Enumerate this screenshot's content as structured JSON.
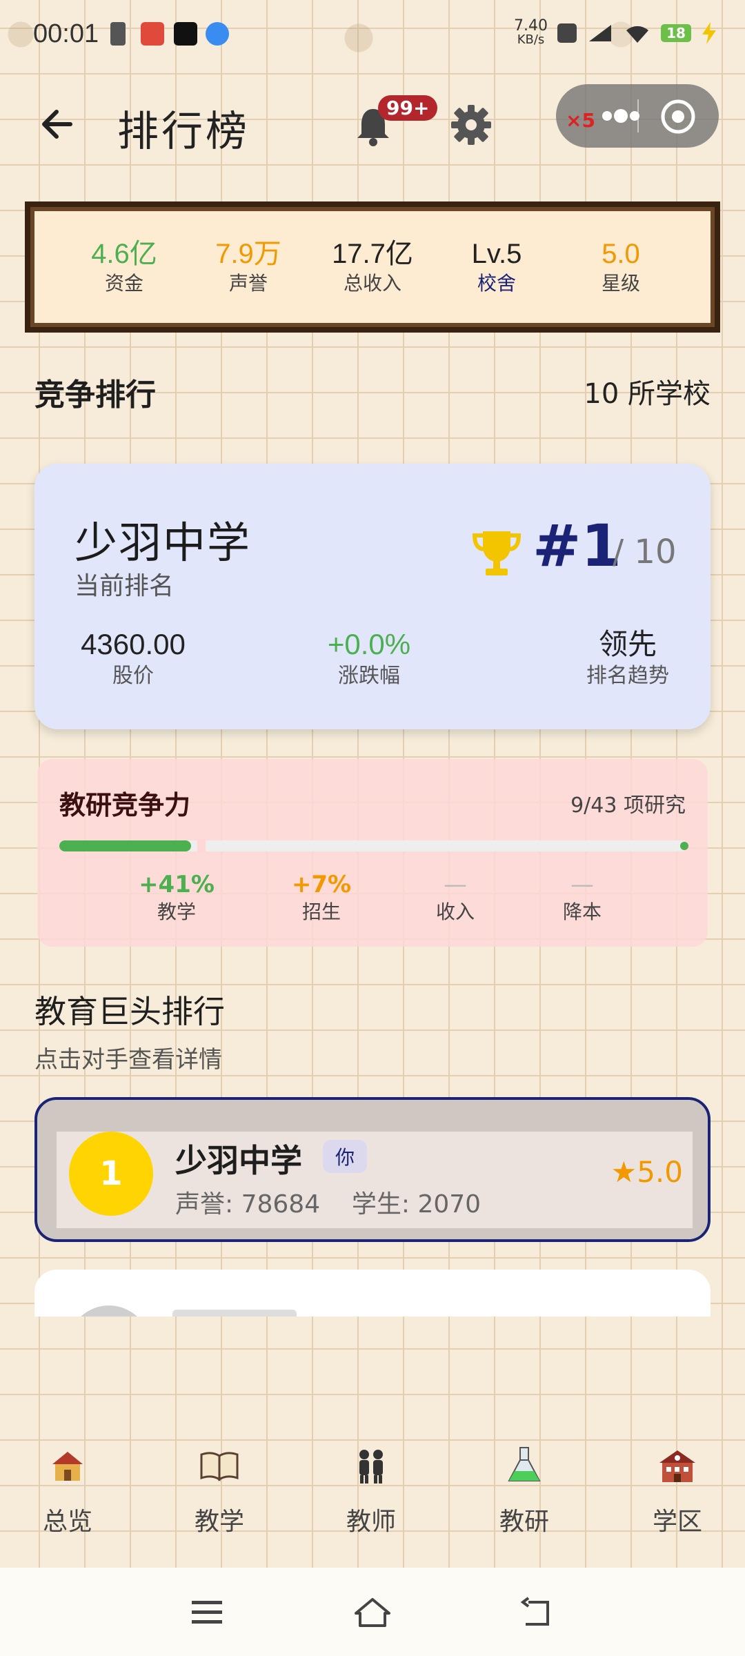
{
  "status_bar": {
    "time": "00:01",
    "net_speed_top": "7.40",
    "net_speed_bottom": "KB/s",
    "battery": "18"
  },
  "header": {
    "title": "排行榜",
    "notification_badge": "99+",
    "capsule_badge": "×5"
  },
  "stats": [
    {
      "value": "4.6亿",
      "label": "资金",
      "color": "#4caf50"
    },
    {
      "value": "7.9万",
      "label": "声誉",
      "color": "#f29800"
    },
    {
      "value": "17.7亿",
      "label": "总收入",
      "color": "#222222"
    },
    {
      "value": "Lv.5",
      "label": "校舍",
      "color": "#222222"
    },
    {
      "value": "5.0",
      "label": "星级",
      "color": "#f29800"
    }
  ],
  "competition": {
    "title": "竞争排行",
    "count": "10 所学校"
  },
  "rank_card": {
    "school": "少羽中学",
    "subtitle": "当前排名",
    "rank": "#1",
    "total": "/ 10",
    "stock_price": "4360.00",
    "stock_label": "股价",
    "change": "+0.0%",
    "change_label": "涨跌幅",
    "trend": "领先",
    "trend_label": "排名趋势"
  },
  "research": {
    "title": "教研竞争力",
    "count": "9/43 项研究",
    "progress": 0.21,
    "items": [
      {
        "value": "+41%",
        "label": "教学",
        "color": "#4caf50"
      },
      {
        "value": "+7%",
        "label": "招生",
        "color": "#f29800"
      },
      {
        "value": "—",
        "label": "收入",
        "color": "#bbbbbb"
      },
      {
        "value": "—",
        "label": "降本",
        "color": "#bbbbbb"
      }
    ]
  },
  "giants": {
    "title": "教育巨头排行",
    "subtitle": "点击对手查看详情",
    "rows": [
      {
        "rank": "1",
        "name": "少羽中学",
        "tag": "你",
        "stats": "声誉: 78684    学生: 2070",
        "stars": "★5.0"
      }
    ]
  },
  "nav": [
    {
      "label": "总览",
      "icon": "school-house-icon"
    },
    {
      "label": "教学",
      "icon": "open-book-icon"
    },
    {
      "label": "教师",
      "icon": "teachers-icon"
    },
    {
      "label": "教研",
      "icon": "flask-icon"
    },
    {
      "label": "学区",
      "icon": "school-district-icon"
    }
  ]
}
